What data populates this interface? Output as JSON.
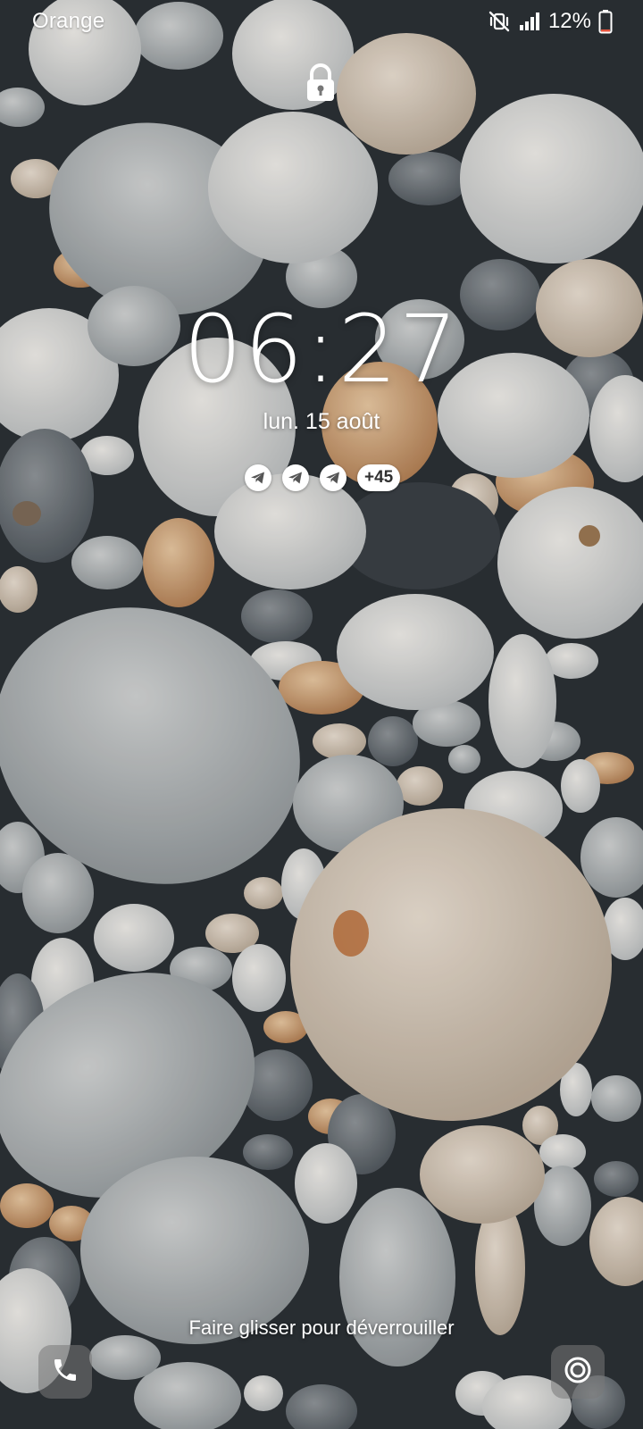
{
  "status_bar": {
    "carrier": "Orange",
    "battery_percent": "12%",
    "icons": [
      "mute-vibrate-icon",
      "signal-icon",
      "battery-icon"
    ],
    "battery_level": 0.12,
    "battery_color": "#e5533d"
  },
  "lock_screen": {
    "lock_icon": "padlock-icon",
    "time": "06:27",
    "date": "lun. 15 août",
    "notifications": {
      "icons": [
        "telegram-icon",
        "telegram-icon",
        "telegram-icon"
      ],
      "more_count": "+45"
    },
    "unlock_hint": "Faire glisser pour déverrouiller",
    "shortcuts": {
      "left": "phone-icon",
      "right": "camera-icon"
    }
  },
  "wallpaper": "pebbles"
}
